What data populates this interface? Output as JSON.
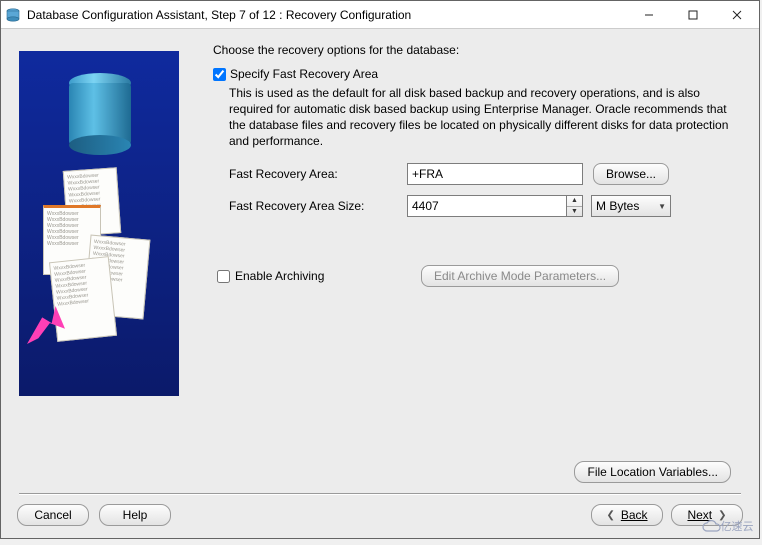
{
  "window": {
    "title": "Database Configuration Assistant, Step 7 of 12 : Recovery Configuration"
  },
  "header": "Choose the recovery options for the database:",
  "specify": {
    "checked": true,
    "label": "Specify Fast Recovery Area",
    "description": "This is used as the default for all disk based backup and recovery operations, and is also required for automatic disk based backup using Enterprise Manager. Oracle recommends that the database files and recovery files be located on physically different disks for data protection and performance."
  },
  "fra": {
    "area_label": "Fast Recovery Area:",
    "area_value": "+FRA",
    "browse": "Browse...",
    "size_label": "Fast Recovery Area Size:",
    "size_value": "4407",
    "size_unit": "M Bytes"
  },
  "archive": {
    "checked": false,
    "label": "Enable Archiving",
    "edit_button": "Edit Archive Mode Parameters..."
  },
  "file_loc_button": "File Location Variables...",
  "nav": {
    "cancel": "Cancel",
    "help": "Help",
    "back": "Back",
    "next": "Next"
  },
  "watermark": "亿速云"
}
